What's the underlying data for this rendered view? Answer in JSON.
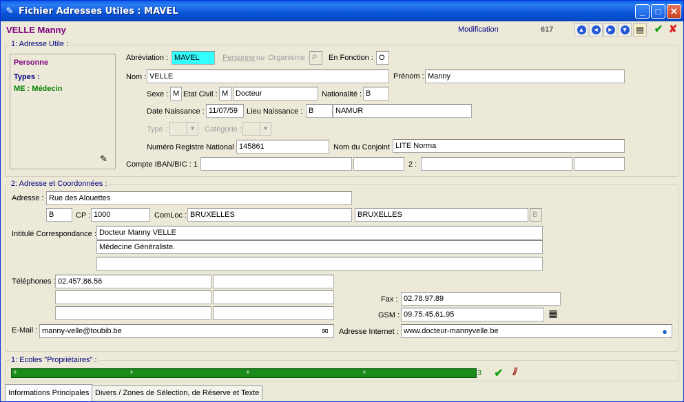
{
  "window": {
    "title": "Fichier Adresses Utiles : MAVEL"
  },
  "header": {
    "name": "VELLE Manny",
    "mode": "Modification",
    "count": "617"
  },
  "section1": {
    "legend": "1: Adresse Utile :",
    "side": {
      "kind": "Personne",
      "types_label": "Types :",
      "type_value": "ME : Médecin"
    },
    "abbrev_label": "Abréviation :",
    "abbrev": "MAVEL",
    "personne_label": "Personne",
    "ou_label": "ou",
    "organisme_label": "Organisme :",
    "po_value": "P",
    "en_fonction_label": "En Fonction :",
    "en_fonction": "O",
    "nom_label": "Nom :",
    "nom": "VELLE",
    "prenom_label": "Prénom :",
    "prenom": "Manny",
    "sexe_label": "Sexe :",
    "sexe": "M",
    "etat_civil_label": "Etat Civil :",
    "etat_civil_code": "M",
    "etat_civil": "Docteur",
    "nationalite_label": "Nationalité :",
    "nationalite": "B",
    "date_naiss_label": "Date Naissance :",
    "date_naiss": "11/07/59",
    "lieu_naiss_label": "Lieu Naissance :",
    "lieu_naiss_code": "B",
    "lieu_naiss": "NAMUR",
    "type_label": "Type :",
    "categorie_label": "Catégorie :",
    "nrn_label": "Numéro Registre National :",
    "nrn": "145861",
    "conjoint_label": "Nom du Conjoint :",
    "conjoint": "LITE Norma",
    "iban_label": "Compte IBAN/BIC : 1 :",
    "iban2_label": "2 :"
  },
  "section2": {
    "legend": "2: Adresse et Coordonnées :",
    "adresse_label": "Adresse :",
    "adresse": "Rue des Alouettes",
    "pays": "B",
    "cp_label": "CP :",
    "cp": "1000",
    "comloc_label": "ComLoc :",
    "comloc": "BRUXELLES",
    "comloc2": "BRUXELLES",
    "comloc_code": "B",
    "intitule_label": "Intitulé Correspondance :",
    "intitule1": "Docteur Manny VELLE",
    "intitule2": "Médecine Généraliste.",
    "tel_label": "Téléphones :",
    "tel1": "02.457.86.56",
    "fax_label": "Fax :",
    "fax": "02.78.97.89",
    "gsm_label": "GSM :",
    "gsm": "09.75.45.61.95",
    "email_label": "E-Mail :",
    "email": "manny-velle@toubib.be",
    "internet_label": "Adresse Internet :",
    "internet": "www.docteur-mannyvelle.be"
  },
  "section3": {
    "legend": "1: Ecoles \"Propriétaires\" :",
    "plus": "+",
    "count": "3"
  },
  "tabs": {
    "tab1": "Informations Principales",
    "tab2": "Divers / Zones de Sélection, de Réserve et Texte"
  },
  "colors": {
    "accent": "#0a5fe8",
    "name": "#800080",
    "bar": "#1a8a1a"
  }
}
